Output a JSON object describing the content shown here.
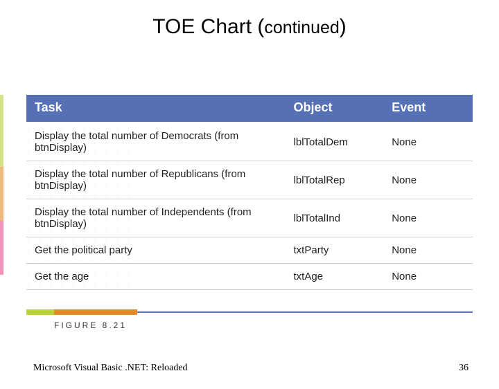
{
  "title_main": "TOE Chart (",
  "title_cont": "continued",
  "title_close": ")",
  "table": {
    "headers": {
      "task": "Task",
      "object": "Object",
      "event": "Event"
    },
    "rows": [
      {
        "task": "Display the total number of Democrats (from btnDisplay)",
        "object": "lblTotalDem",
        "event": "None"
      },
      {
        "task": "Display the total number of Republicans (from btnDisplay)",
        "object": "lblTotalRep",
        "event": "None"
      },
      {
        "task": "Display the total number of Independents (from btnDisplay)",
        "object": "lblTotalInd",
        "event": "None"
      },
      {
        "task": "Get the political party",
        "object": "txtParty",
        "event": "None"
      },
      {
        "task": "Get the age",
        "object": "txtAge",
        "event": "None"
      }
    ]
  },
  "figure_label": "FIGURE 8.21",
  "footer_left": "Microsoft Visual Basic .NET: Reloaded",
  "page_number": "36"
}
